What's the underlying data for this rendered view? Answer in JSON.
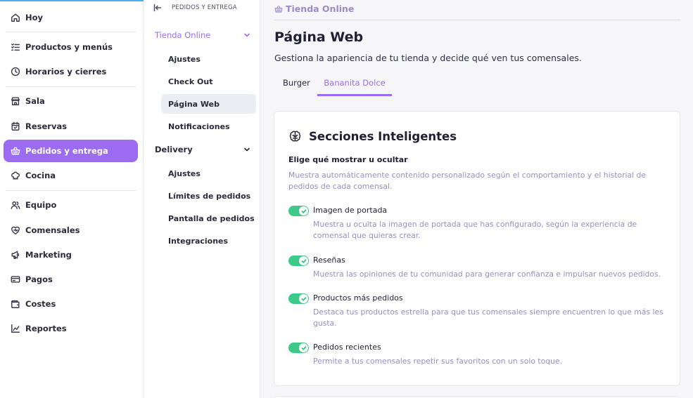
{
  "sidebar": {
    "items": [
      {
        "label": "Hoy",
        "icon": "home-icon"
      },
      {
        "label": "Productos y menús",
        "icon": "list-check-icon"
      },
      {
        "label": "Horarios y cierres",
        "icon": "clock-icon"
      },
      {
        "label": "Sala",
        "icon": "store-icon"
      },
      {
        "label": "Reservas",
        "icon": "calendar-icon"
      },
      {
        "label": "Pedidos y entrega",
        "icon": "basket-icon"
      },
      {
        "label": "Cocina",
        "icon": "chef-hat-icon"
      },
      {
        "label": "Equipo",
        "icon": "users-icon"
      },
      {
        "label": "Comensales",
        "icon": "heart-icon"
      },
      {
        "label": "Marketing",
        "icon": "megaphone-icon"
      },
      {
        "label": "Pagos",
        "icon": "credit-card-icon"
      },
      {
        "label": "Costes",
        "icon": "wallet-icon"
      },
      {
        "label": "Reportes",
        "icon": "chart-icon"
      }
    ],
    "active_index": 5,
    "accent_color": "#9b6cf2"
  },
  "submenu": {
    "header": "PEDIDOS Y ENTREGA",
    "group1": {
      "label": "Tienda Online",
      "items": [
        "Ajustes",
        "Check Out",
        "Página Web",
        "Notificaciones"
      ]
    },
    "group2": {
      "label": "Delivery",
      "items": [
        "Ajustes",
        "Límites de pedidos",
        "Pantalla de pedidos",
        "Integraciones"
      ]
    },
    "active_item": "Página Web"
  },
  "main": {
    "breadcrumb": "Tienda Online",
    "title": "Página Web",
    "subtitle": "Gestiona la apariencia de tu tienda y decide qué ven tus comensales.",
    "tabs": [
      {
        "label": "Burger",
        "active": false
      },
      {
        "label": "Bananita Dolce",
        "active": true
      }
    ],
    "card": {
      "title": "Secciones Inteligentes",
      "label": "Elige qué mostrar u ocultar",
      "description": "Muestra automáticamente contenido personalizado según el comportamiento y el historial de pedidos de cada comensal.",
      "options": [
        {
          "label": "Imagen de portada",
          "enabled": true,
          "description": "Muestra u oculta la imagen de portada que has configurado, según la experiencia de comensal que quieras crear."
        },
        {
          "label": "Reseñas",
          "enabled": true,
          "description": "Muestra las opiniones de tu comunidad para generar confianza e impulsar nuevos pedidos."
        },
        {
          "label": "Productos más pedidos",
          "enabled": true,
          "description": "Destaca tus productos estrella para que tus comensales siempre encuentren lo que más les gusta."
        },
        {
          "label": "Pedidos recientes",
          "enabled": true,
          "description": "Permite a tus comensales repetir sus favoritos con un solo toque."
        }
      ]
    },
    "toggle_color": "#3ec98a"
  }
}
